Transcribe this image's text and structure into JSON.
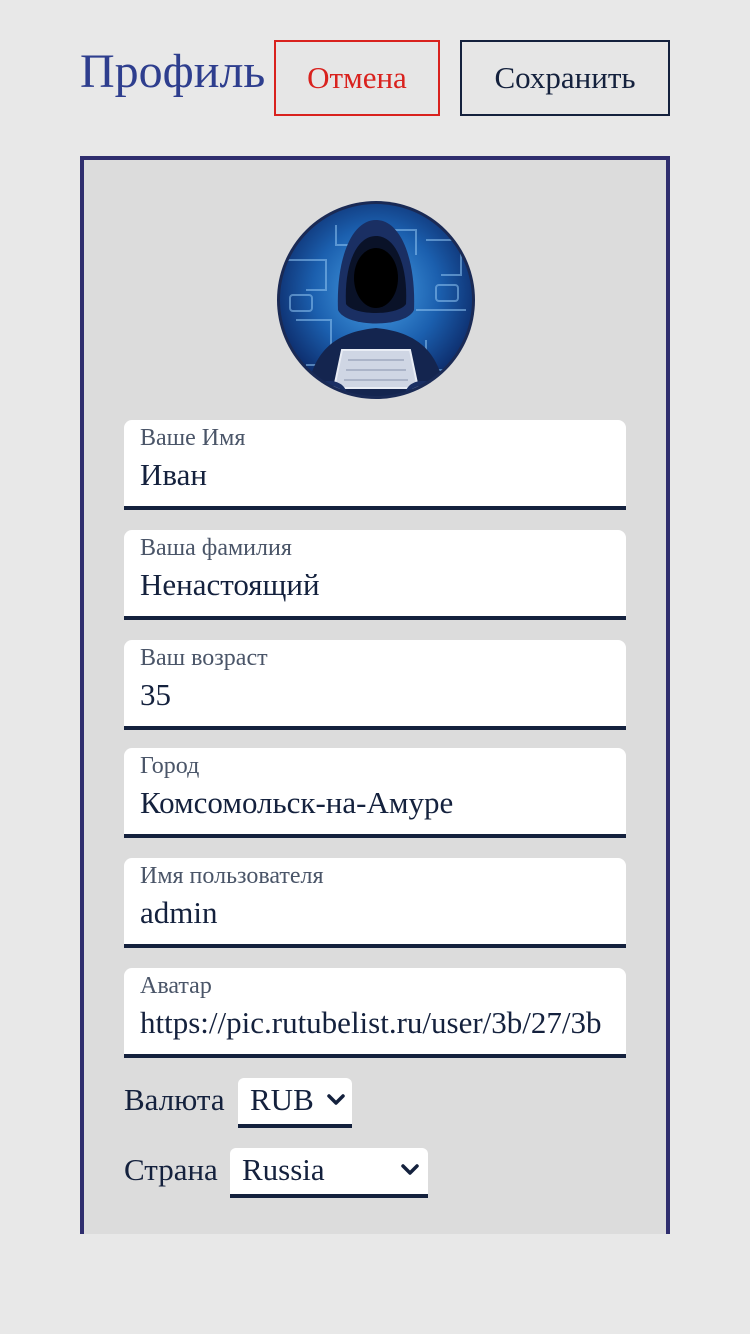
{
  "header": {
    "title": "Профиль",
    "cancel_label": "Отмена",
    "save_label": "Сохранить"
  },
  "profile": {
    "avatar_icon": "hacker-avatar-image",
    "fields": [
      {
        "label": "Ваше Имя",
        "value": "Иван"
      },
      {
        "label": "Ваша фамилия",
        "value": "Ненастоящий"
      },
      {
        "label": "Ваш возраст",
        "value": "35"
      },
      {
        "label": "Город",
        "value": "Комсомольск-на-Амуре"
      },
      {
        "label": "Имя пользователя",
        "value": "admin"
      },
      {
        "label": "Аватар",
        "value": "https://pic.rutubelist.ru/user/3b/27/3b"
      }
    ],
    "currency": {
      "label": "Валюта",
      "value": "RUB"
    },
    "country": {
      "label": "Страна",
      "value": "Russia"
    }
  },
  "colors": {
    "background": "#e8e8e8",
    "accent_title": "#2e3e8e",
    "cancel": "#d9221e",
    "text_dark": "#14213d",
    "card_border": "#2f2e6e"
  }
}
